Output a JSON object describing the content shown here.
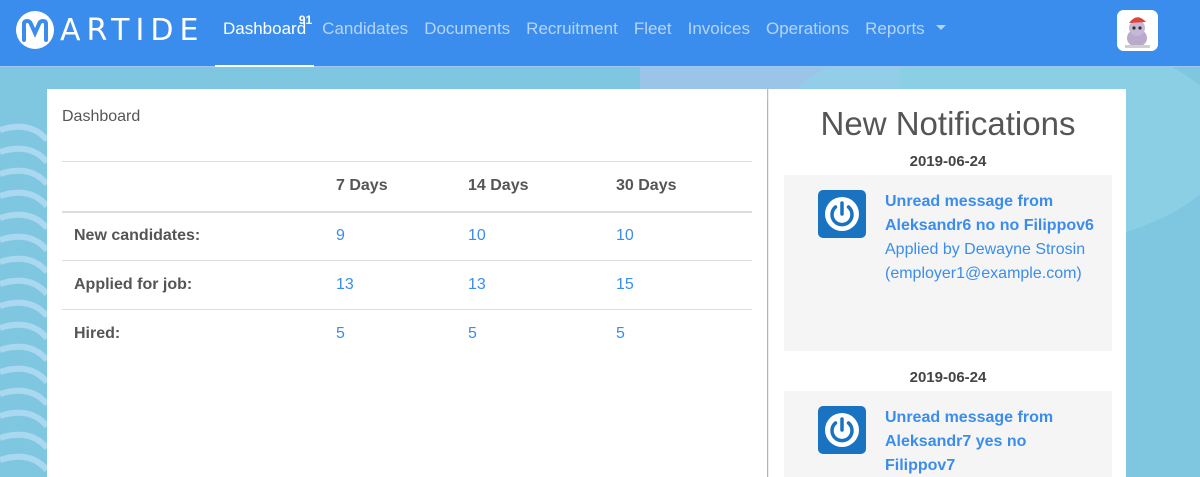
{
  "brand": {
    "name": "ARTIDE",
    "logo_letter": "M"
  },
  "nav": {
    "items": [
      {
        "label": "Dashboard",
        "badge": "91"
      },
      {
        "label": "Candidates"
      },
      {
        "label": "Documents"
      },
      {
        "label": "Recruitment"
      },
      {
        "label": "Fleet"
      },
      {
        "label": "Invoices"
      },
      {
        "label": "Operations"
      },
      {
        "label": "Reports"
      }
    ]
  },
  "dashboard": {
    "title": "Dashboard",
    "columns": [
      "",
      "7 Days",
      "14 Days",
      "30 Days"
    ],
    "rows": [
      {
        "label": "New candidates:",
        "values": [
          "9",
          "10",
          "10"
        ]
      },
      {
        "label": "Applied for job:",
        "values": [
          "13",
          "13",
          "15"
        ]
      },
      {
        "label": "Hired:",
        "values": [
          "5",
          "5",
          "5"
        ]
      }
    ]
  },
  "notifications": {
    "heading": "New Notifications",
    "items": [
      {
        "date": "2019-06-24",
        "title": "Unread message from Aleksandr6 no no Filippov6",
        "subtitle": "Applied by Dewayne Strosin (employer1@example.com)"
      },
      {
        "date": "2019-06-24",
        "title": "Unread message from Aleksandr7 yes no Filippov7",
        "subtitle": ""
      }
    ]
  },
  "colors": {
    "navbar": "#3b8ded",
    "link": "#3b8ded",
    "icon": "#1a73c0"
  }
}
